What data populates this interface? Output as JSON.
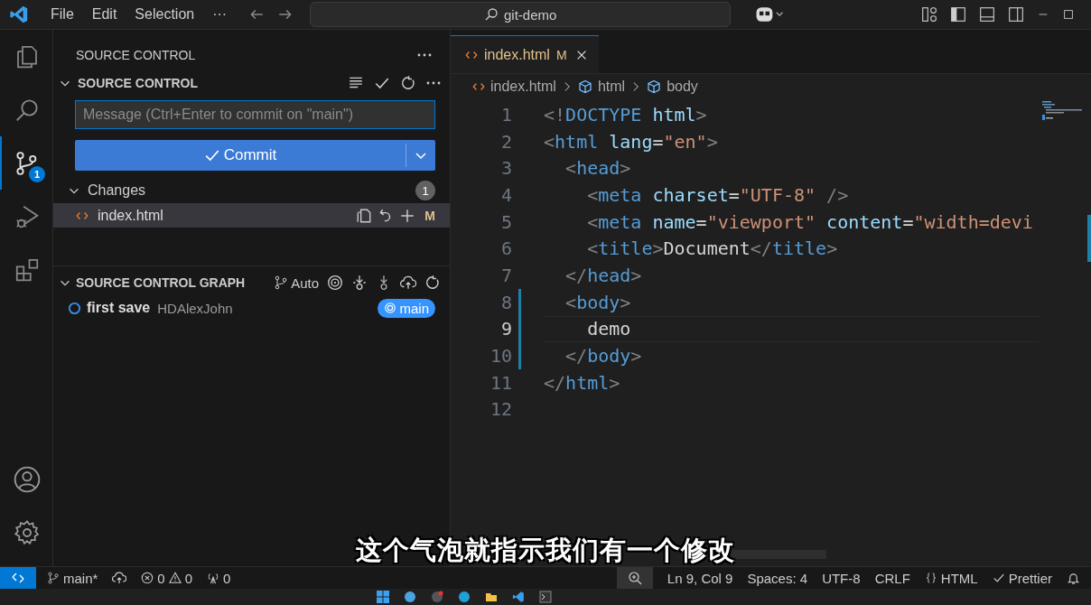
{
  "title_bar": {
    "menu": [
      "File",
      "Edit",
      "Selection",
      "···"
    ],
    "search": "git-demo"
  },
  "activity_bar": [
    {
      "kind": "files",
      "selected": false
    },
    {
      "kind": "search",
      "selected": false
    },
    {
      "kind": "source-control",
      "selected": true,
      "badge": "1"
    },
    {
      "kind": "debug",
      "selected": false
    },
    {
      "kind": "extensions",
      "selected": false
    }
  ],
  "sidebar": {
    "title": "SOURCE CONTROL",
    "section": "SOURCE CONTROL",
    "message": {
      "placeholder": "Message (Ctrl+Enter to commit on \"main\")"
    },
    "commit_button": "Commit",
    "changes": {
      "label": "Changes",
      "count": "1",
      "expanded": true,
      "files": [
        {
          "name": "index.html",
          "status": "M",
          "selected": true
        }
      ]
    },
    "graph": {
      "title": "SOURCE CONTROL GRAPH",
      "mode": "Auto",
      "expanded": true,
      "commits": [
        {
          "message": "first save",
          "author": "HDAlexJohn",
          "branch": "main"
        }
      ]
    }
  },
  "editor": {
    "tabs": [
      {
        "name": "index.html",
        "status": "M",
        "selected": true
      }
    ],
    "breadcrumbs": [
      {
        "kind": "file",
        "label": "index.html"
      },
      {
        "kind": "element",
        "label": "html"
      },
      {
        "kind": "element",
        "label": "body"
      }
    ],
    "lines": [
      {
        "n": "1",
        "current": false,
        "modified": false,
        "tokens": [
          {
            "kind": "p",
            "t": "<!"
          },
          {
            "kind": "tag",
            "t": "DOCTYPE"
          },
          {
            "kind": "attr",
            "t": " html"
          },
          {
            "kind": "p",
            "t": ">"
          }
        ]
      },
      {
        "n": "2",
        "current": false,
        "modified": false,
        "tokens": [
          {
            "kind": "p",
            "t": "<"
          },
          {
            "kind": "tag",
            "t": "html"
          },
          {
            "kind": "attr",
            "t": " lang"
          },
          {
            "kind": "text",
            "t": "="
          },
          {
            "kind": "str",
            "t": "\"en\""
          },
          {
            "kind": "p",
            "t": ">"
          }
        ]
      },
      {
        "n": "3",
        "current": false,
        "modified": false,
        "tokens": [
          {
            "kind": "p",
            "t": "  <"
          },
          {
            "kind": "tag",
            "t": "head"
          },
          {
            "kind": "p",
            "t": ">"
          }
        ]
      },
      {
        "n": "4",
        "current": false,
        "modified": false,
        "tokens": [
          {
            "kind": "p",
            "t": "    <"
          },
          {
            "kind": "tag",
            "t": "meta"
          },
          {
            "kind": "attr",
            "t": " charset"
          },
          {
            "kind": "text",
            "t": "="
          },
          {
            "kind": "str",
            "t": "\"UTF-8\""
          },
          {
            "kind": "p",
            "t": " />"
          }
        ]
      },
      {
        "n": "5",
        "current": false,
        "modified": false,
        "tokens": [
          {
            "kind": "p",
            "t": "    <"
          },
          {
            "kind": "tag",
            "t": "meta"
          },
          {
            "kind": "attr",
            "t": " name"
          },
          {
            "kind": "text",
            "t": "="
          },
          {
            "kind": "str",
            "t": "\"viewport\""
          },
          {
            "kind": "attr",
            "t": " content"
          },
          {
            "kind": "text",
            "t": "="
          },
          {
            "kind": "str",
            "t": "\"width=devi"
          }
        ]
      },
      {
        "n": "6",
        "current": false,
        "modified": false,
        "tokens": [
          {
            "kind": "p",
            "t": "    <"
          },
          {
            "kind": "tag",
            "t": "title"
          },
          {
            "kind": "p",
            "t": ">"
          },
          {
            "kind": "text",
            "t": "Document"
          },
          {
            "kind": "p",
            "t": "</"
          },
          {
            "kind": "tag",
            "t": "title"
          },
          {
            "kind": "p",
            "t": ">"
          }
        ]
      },
      {
        "n": "7",
        "current": false,
        "modified": false,
        "tokens": [
          {
            "kind": "p",
            "t": "  </"
          },
          {
            "kind": "tag",
            "t": "head"
          },
          {
            "kind": "p",
            "t": ">"
          }
        ]
      },
      {
        "n": "8",
        "current": false,
        "modified": true,
        "tokens": [
          {
            "kind": "p",
            "t": "  <"
          },
          {
            "kind": "tag",
            "t": "body"
          },
          {
            "kind": "p",
            "t": ">"
          }
        ]
      },
      {
        "n": "9",
        "current": true,
        "modified": true,
        "tokens": [
          {
            "kind": "text",
            "t": "    demo"
          }
        ]
      },
      {
        "n": "10",
        "current": false,
        "modified": true,
        "tokens": [
          {
            "kind": "p",
            "t": "  </"
          },
          {
            "kind": "tag",
            "t": "body"
          },
          {
            "kind": "p",
            "t": ">"
          }
        ]
      },
      {
        "n": "11",
        "current": false,
        "modified": false,
        "tokens": [
          {
            "kind": "p",
            "t": "</"
          },
          {
            "kind": "tag",
            "t": "html"
          },
          {
            "kind": "p",
            "t": ">"
          }
        ]
      },
      {
        "n": "12",
        "current": false,
        "modified": false
      }
    ]
  },
  "status_bar": {
    "branch": "main*",
    "errors": "0",
    "warnings": "0",
    "ports": "0",
    "position": "Ln 9, Col 9",
    "spaces": "Spaces: 4",
    "encoding": "UTF-8",
    "eol": "CRLF",
    "language": "HTML",
    "formatter": "Prettier"
  },
  "subtitle": "这个气泡就指示我们有一个修改"
}
